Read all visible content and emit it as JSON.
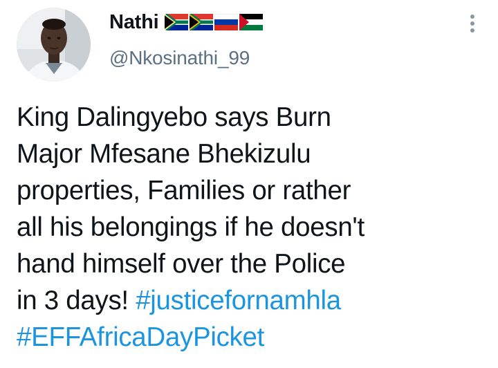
{
  "author": {
    "display_name": "Nathi",
    "handle": "@Nkosinathi_99",
    "flags": [
      "south-africa-flag",
      "south-africa-flag",
      "russia-flag",
      "palestine-flag"
    ]
  },
  "menu": {
    "icon": "more-vertical-icon"
  },
  "tweet": {
    "lines": [
      "King Dalingyebo says Burn",
      "Major Mfesane Bhekizulu",
      "properties, Families or rather",
      "all his belongings if he doesn't",
      "hand himself over the Police",
      "in 3 days! "
    ],
    "hashtag_1": "#justicefornamhla",
    "hashtag_2": "#EFFAfricaDayPicket"
  },
  "colors": {
    "text": "#0f1419",
    "secondary": "#5b7083",
    "link": "#1b95e0"
  }
}
